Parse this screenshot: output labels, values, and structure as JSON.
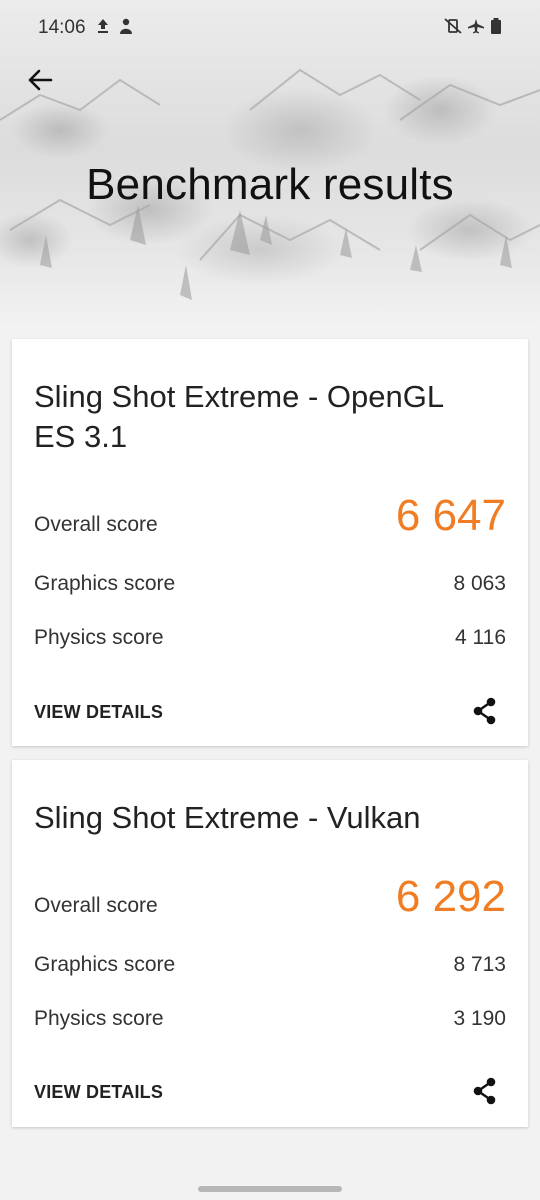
{
  "status_bar": {
    "time": "14:06",
    "left_icons": [
      "upload-icon",
      "person-notification-icon"
    ],
    "right_icons": [
      "vibrate-off-icon",
      "airplane-icon",
      "battery-icon"
    ]
  },
  "header": {
    "title": "Benchmark results",
    "back_icon": "arrow-left-icon"
  },
  "results": [
    {
      "title": "Sling Shot Extreme - OpenGL ES 3.1",
      "overall_label": "Overall score",
      "overall_value": "6 647",
      "graphics_label": "Graphics score",
      "graphics_value": "8 063",
      "physics_label": "Physics score",
      "physics_value": "4 116",
      "details_label": "VIEW DETAILS",
      "share_icon": "share-icon"
    },
    {
      "title": "Sling Shot Extreme - Vulkan",
      "overall_label": "Overall score",
      "overall_value": "6 292",
      "graphics_label": "Graphics score",
      "graphics_value": "8 713",
      "physics_label": "Physics score",
      "physics_value": "3 190",
      "details_label": "VIEW DETAILS",
      "share_icon": "share-icon"
    }
  ],
  "colors": {
    "accent_score": "#f07d23",
    "card_background": "#ffffff",
    "page_background": "#f2f2f2"
  }
}
